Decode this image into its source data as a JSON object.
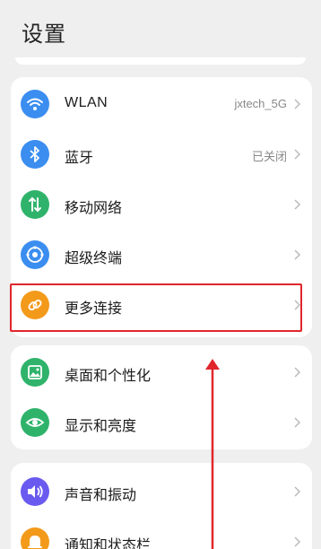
{
  "header": {
    "title": "设置"
  },
  "groups": [
    {
      "items": [
        {
          "label": "WLAN",
          "value": "jxtech_5G",
          "icon": "wifi-icon",
          "color": "#3b8ef0"
        },
        {
          "label": "蓝牙",
          "value": "已关闭",
          "icon": "bluetooth-icon",
          "color": "#3b8ef0"
        },
        {
          "label": "移动网络",
          "value": "",
          "icon": "mobile-data-icon",
          "color": "#2fb36b"
        },
        {
          "label": "超级终端",
          "value": "",
          "icon": "super-device-icon",
          "color": "#3b8ef0"
        },
        {
          "label": "更多连接",
          "value": "",
          "icon": "link-icon",
          "color": "#f39a1b"
        }
      ]
    },
    {
      "items": [
        {
          "label": "桌面和个性化",
          "value": "",
          "icon": "wallpaper-icon",
          "color": "#2fb36b"
        },
        {
          "label": "显示和亮度",
          "value": "",
          "icon": "eye-icon",
          "color": "#2fb36b"
        }
      ]
    },
    {
      "items": [
        {
          "label": "声音和振动",
          "value": "",
          "icon": "speaker-icon",
          "color": "#6a5af0"
        },
        {
          "label": "通知和状态栏",
          "value": "",
          "icon": "bell-icon",
          "color": "#f39a1b"
        }
      ]
    }
  ],
  "annotation": {
    "highlight_color": "#e0262b",
    "highlighted_item": "更多连接"
  }
}
